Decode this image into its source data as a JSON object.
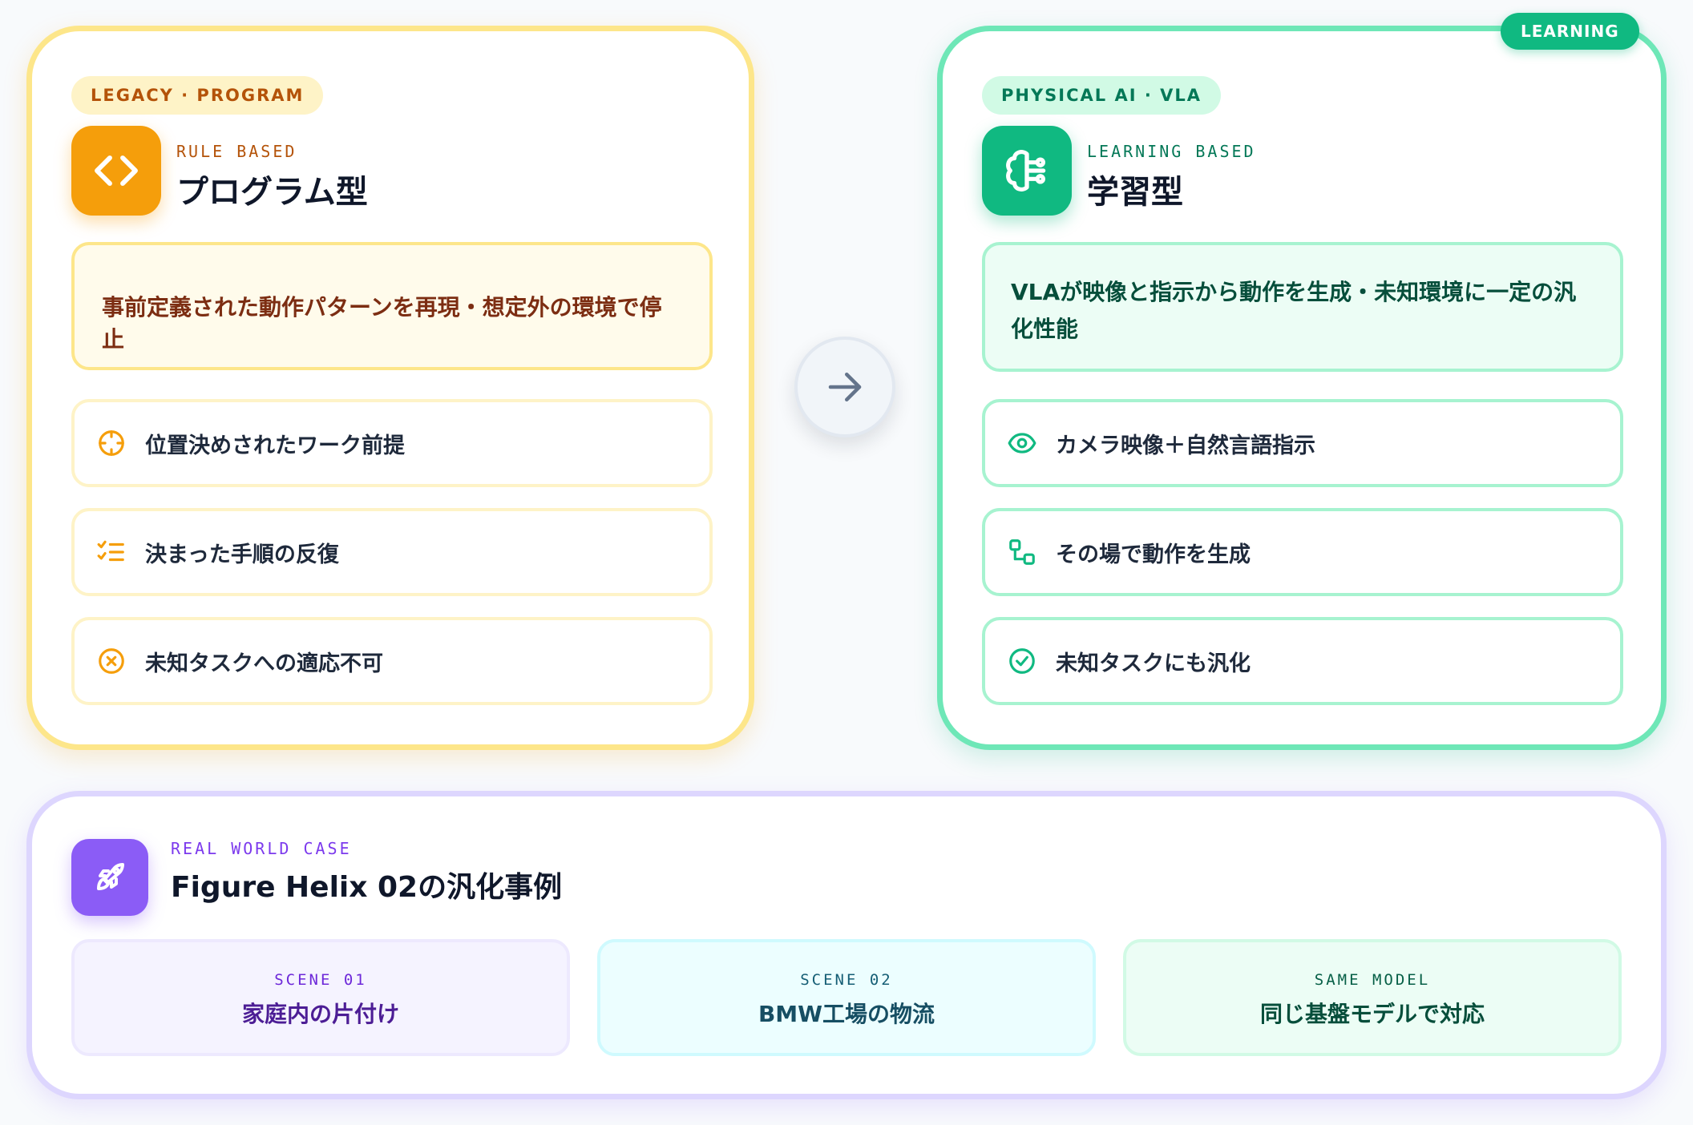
{
  "legacy": {
    "pill": "LEGACY · PROGRAM",
    "kicker": "RULE BASED",
    "title": "プログラム型",
    "summary": "事前定義された動作パターンを再現・想定外の環境で停止",
    "features": [
      {
        "icon": "crosshair-icon",
        "label": "位置決めされたワーク前提"
      },
      {
        "icon": "checklist-icon",
        "label": "決まった手順の反復"
      },
      {
        "icon": "x-circle-icon",
        "label": "未知タスクへの適応不可"
      }
    ],
    "accent": "#f59e0b"
  },
  "learning": {
    "badge": "LEARNING",
    "pill": "PHYSICAL AI · VLA",
    "kicker": "LEARNING BASED",
    "title": "学習型",
    "summary": "VLAが映像と指示から動作を生成・未知環境に一定の汎化性能",
    "features": [
      {
        "icon": "eye-icon",
        "label": "カメラ映像＋自然言語指示"
      },
      {
        "icon": "workflow-icon",
        "label": "その場で動作を生成"
      },
      {
        "icon": "check-circle-icon",
        "label": "未知タスクにも汎化"
      }
    ],
    "accent": "#10b981"
  },
  "case": {
    "kicker": "REAL WORLD CASE",
    "title": "Figure Helix 02の汎化事例",
    "scenes": [
      {
        "kicker": "SCENE 01",
        "label": "家庭内の片付け"
      },
      {
        "kicker": "SCENE 02",
        "label": "BMW工場の物流"
      },
      {
        "kicker": "SAME MODEL",
        "label": "同じ基盤モデルで対応"
      }
    ],
    "accent": "#8b5cf6"
  }
}
